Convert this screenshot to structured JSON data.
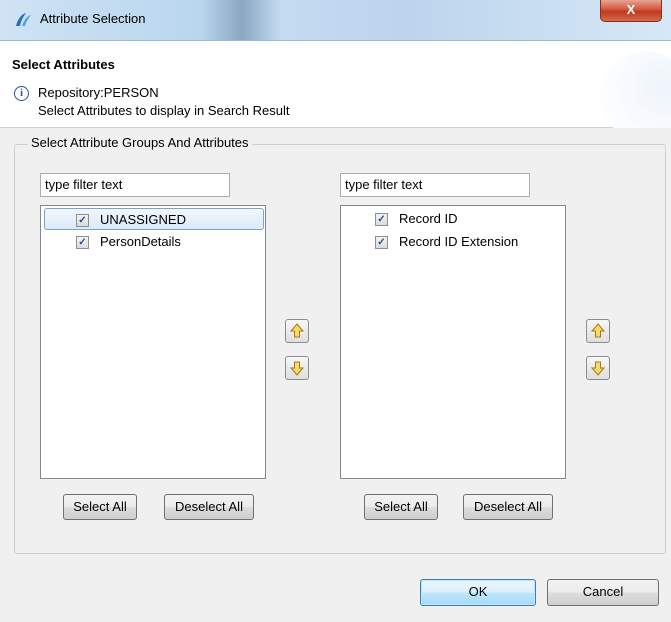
{
  "window": {
    "title": "Attribute Selection",
    "close_label": "X"
  },
  "header": {
    "title": "Select Attributes",
    "repository": "Repository:PERSON",
    "description": "Select Attributes to display in Search Result"
  },
  "group": {
    "label": "Select Attribute Groups And Attributes",
    "left": {
      "filter_value": "type filter text",
      "items": [
        {
          "label": "UNASSIGNED",
          "checked": true,
          "selected": true
        },
        {
          "label": "PersonDetails",
          "checked": true,
          "selected": false
        }
      ],
      "select_all": "Select All",
      "deselect_all": "Deselect All"
    },
    "right": {
      "filter_value": "type filter text",
      "items": [
        {
          "label": "Record ID",
          "checked": true
        },
        {
          "label": "Record ID Extension",
          "checked": true
        }
      ],
      "select_all": "Select All",
      "deselect_all": "Deselect All"
    }
  },
  "footer": {
    "ok": "OK",
    "cancel": "Cancel"
  },
  "icons": {
    "app": "app-logo-icon",
    "info": "info-icon",
    "move_up": "arrow-up-icon",
    "move_down": "arrow-down-icon"
  },
  "colors": {
    "accent": "#3c7fb1",
    "arrow_fill": "#f5d96b",
    "arrow_stroke": "#a27b18"
  }
}
